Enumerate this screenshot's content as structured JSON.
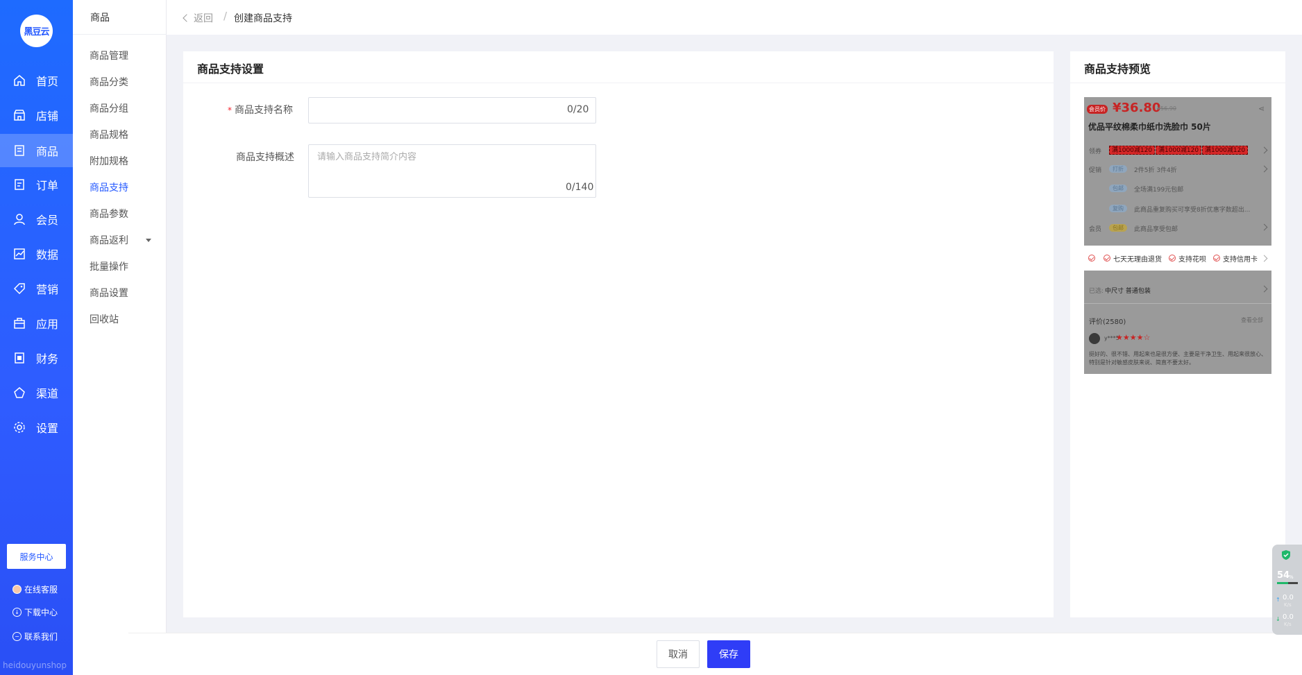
{
  "brand": {
    "logo_text": "黑豆云",
    "watermark": "heidouyunshop"
  },
  "rail": {
    "items": [
      {
        "label": "首页",
        "icon": "home-icon"
      },
      {
        "label": "店铺",
        "icon": "store-icon"
      },
      {
        "label": "商品",
        "icon": "goods-icon",
        "active": true
      },
      {
        "label": "订单",
        "icon": "order-icon"
      },
      {
        "label": "会员",
        "icon": "member-icon"
      },
      {
        "label": "数据",
        "icon": "chart-icon"
      },
      {
        "label": "营销",
        "icon": "tag-icon"
      },
      {
        "label": "应用",
        "icon": "app-icon"
      },
      {
        "label": "财务",
        "icon": "finance-icon"
      },
      {
        "label": "渠道",
        "icon": "channel-icon"
      },
      {
        "label": "设置",
        "icon": "gear-icon"
      }
    ],
    "service_center": "服务中心",
    "links": [
      {
        "label": "在线客服",
        "icon": "support-avatar-icon"
      },
      {
        "label": "下载中心",
        "icon": "download-icon"
      },
      {
        "label": "联系我们",
        "icon": "chat-icon"
      }
    ]
  },
  "subnav": {
    "title": "商品",
    "items": [
      {
        "label": "商品管理"
      },
      {
        "label": "商品分类"
      },
      {
        "label": "商品分组"
      },
      {
        "label": "商品规格"
      },
      {
        "label": "附加规格"
      },
      {
        "label": "商品支持",
        "active": true
      },
      {
        "label": "商品参数"
      },
      {
        "label": "商品返利",
        "has_dropdown": true
      },
      {
        "label": "批量操作"
      },
      {
        "label": "商品设置"
      },
      {
        "label": "回收站"
      }
    ]
  },
  "breadcrumb": {
    "back": "返回",
    "separator": "/",
    "current": "创建商品支持"
  },
  "form": {
    "title": "商品支持设置",
    "name_label": "商品支持名称",
    "name_value": "",
    "name_counter": "0/20",
    "desc_label": "商品支持概述",
    "desc_placeholder": "请输入商品支持简介内容",
    "desc_counter": "0/140"
  },
  "preview": {
    "title": "商品支持预览",
    "tag": "会员价",
    "price": "¥36.80",
    "orig_price": "¥56.90",
    "product_name": "优品平纹棉柔巾纸巾洗脸巾 50片",
    "coupon_label": "领券",
    "coupons": [
      "满1000减120",
      "满1000减120",
      "满1000减120"
    ],
    "promo_label": "促销",
    "promos": [
      {
        "pill": "打折",
        "text": "2件5折  3件4折"
      },
      {
        "pill": "包邮",
        "text": "全场满199元包邮"
      },
      {
        "pill": "复购",
        "text": "此商品重复购买可享受8折优惠字数超出..."
      }
    ],
    "member_label": "会员",
    "member_pill": "包邮",
    "member_text": "此商品享受包邮",
    "supports": [
      "七天无理由退货",
      "支持花呗",
      "支持信用卡"
    ],
    "selected_label": "已选:",
    "selected_value": "中尺寸  普通包装",
    "review_title": "评价(2580)",
    "review_all": "查看全部",
    "reviewer": "y***5",
    "stars": "★★★★☆",
    "review_text": "挺好的、很不错、用起来也是很方便、主要是干净卫生、用起来很放心、特别是针对敏感皮肤来说、简直不要太好。"
  },
  "footer": {
    "cancel": "取消",
    "save": "保存"
  },
  "net_widget": {
    "percent": "54",
    "unit": "%",
    "up": "0.0",
    "up_unit": "K/s",
    "down": "0.0",
    "down_unit": "K/s"
  }
}
